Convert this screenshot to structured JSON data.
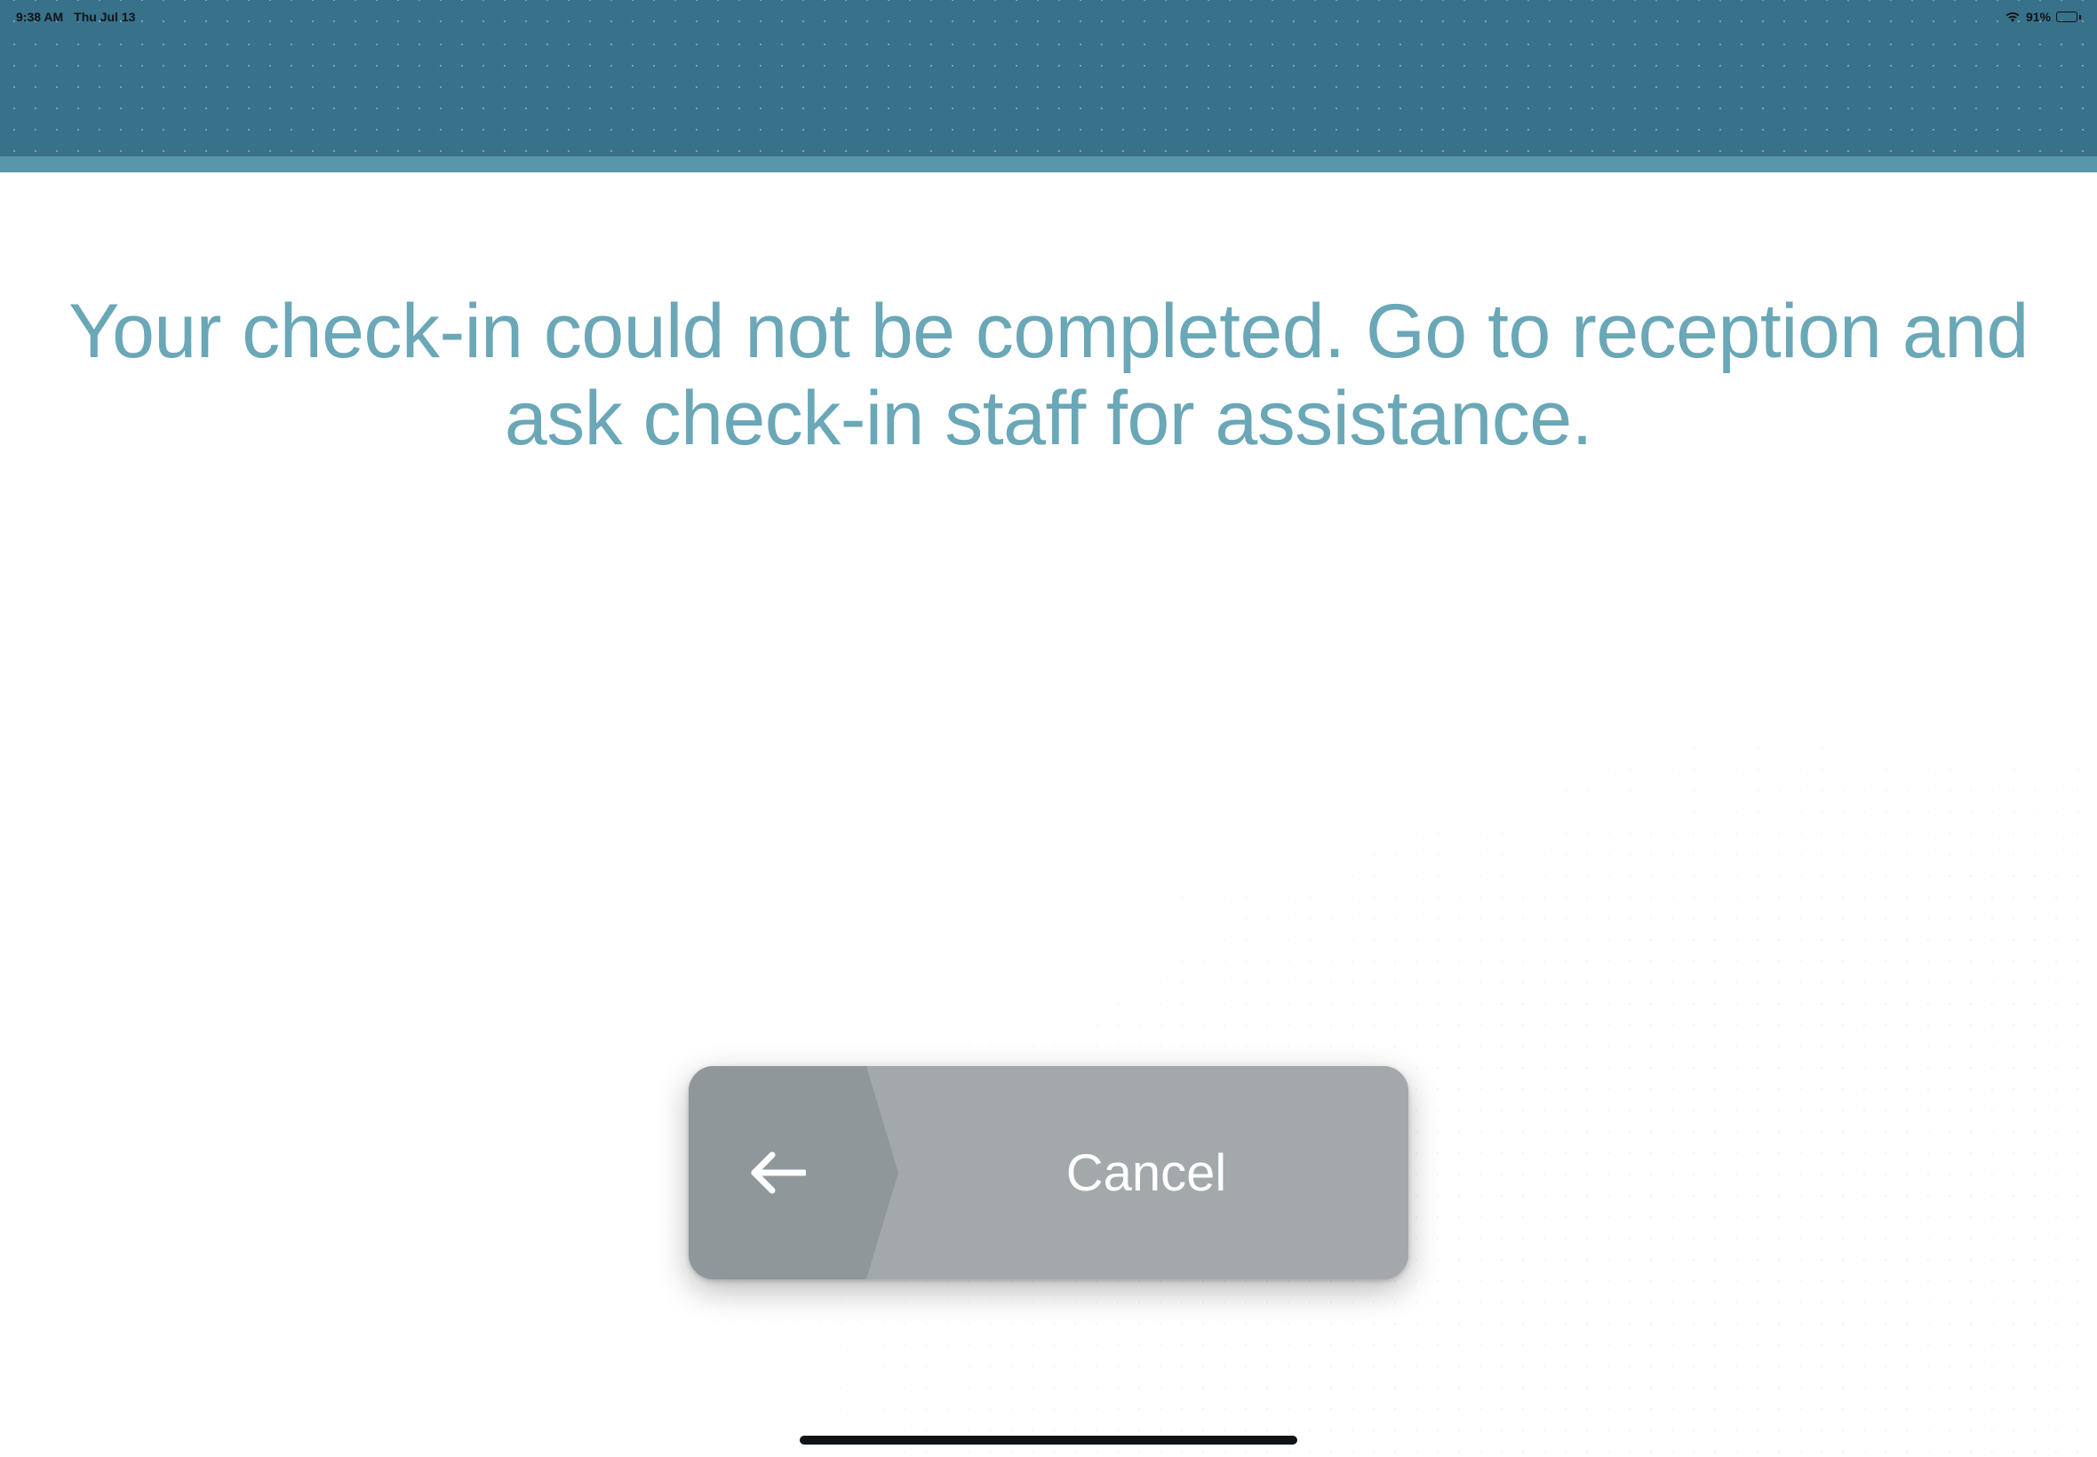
{
  "status": {
    "time": "9:38 AM",
    "date": "Thu Jul 13",
    "battery_percent": "91%"
  },
  "main": {
    "message": "Your check-in could not be completed. Go to reception and ask check-in staff for assistance."
  },
  "actions": {
    "cancel_label": "Cancel"
  },
  "colors": {
    "header_bg": "#38718a",
    "header_divider": "#5797a9",
    "message_text": "#6aa7b7",
    "button_bg": "#a3a8ab",
    "button_icon_bg": "#90979b",
    "button_text": "#ffffff"
  }
}
